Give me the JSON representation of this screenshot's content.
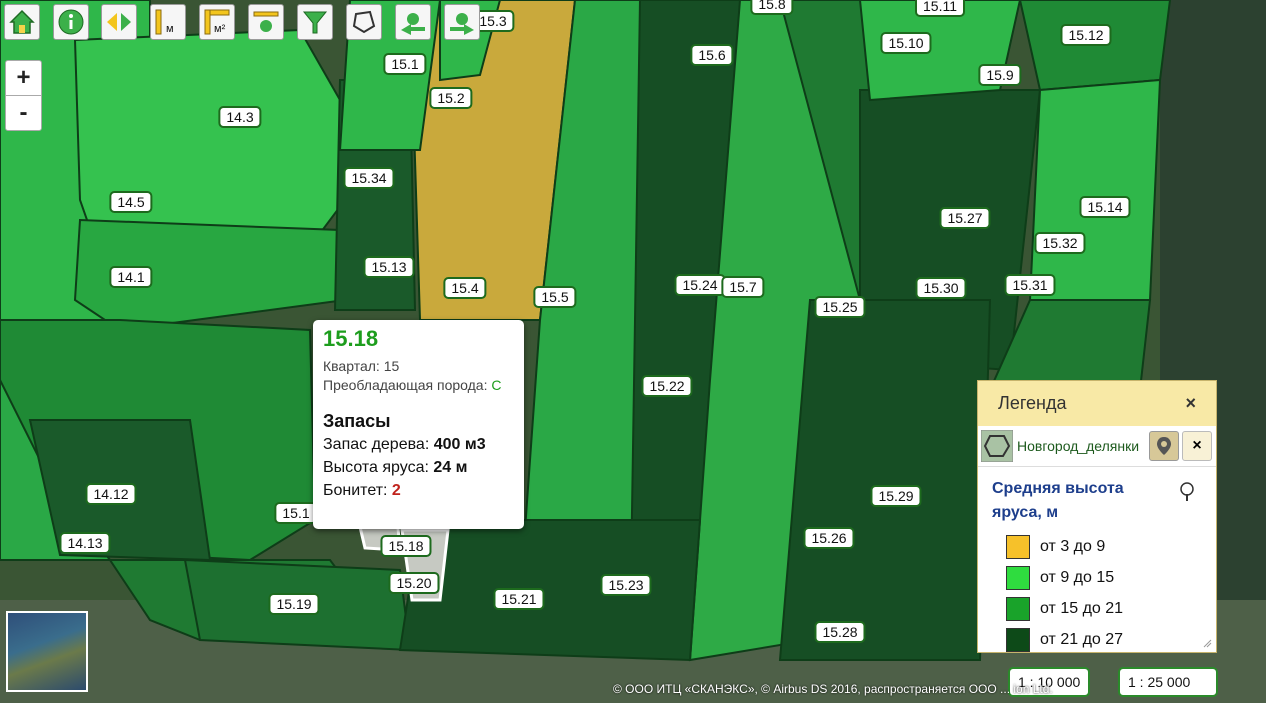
{
  "toolbar": [
    {
      "name": "home-icon"
    },
    {
      "name": "info-icon"
    },
    {
      "name": "pan-icon"
    },
    {
      "name": "measure-length-icon",
      "label": "м"
    },
    {
      "name": "measure-area-icon",
      "label": "м²"
    },
    {
      "name": "layers-icon"
    },
    {
      "name": "filter-icon"
    },
    {
      "name": "polygon-select-icon"
    },
    {
      "name": "zoom-prev-icon"
    },
    {
      "name": "zoom-next-icon"
    }
  ],
  "zoom": {
    "plus": "+",
    "minus": "-"
  },
  "parcels": [
    "15.3",
    "15.8",
    "15.11",
    "15.1",
    "15.6",
    "15.10",
    "15.12",
    "15.9",
    "14.3",
    "15.2",
    "15.34",
    "14.5",
    "15.27",
    "15.14",
    "15.32",
    "15.13",
    "14.1",
    "15.4",
    "15.5",
    "15.24",
    "15.7",
    "15.30",
    "15.31",
    "15.25",
    "15.22",
    "14.12",
    "15.1",
    "15.29",
    "14.13",
    "15.18",
    "15.26",
    "15.20",
    "15.23",
    "15.21",
    "15.19",
    "15.28"
  ],
  "popup": {
    "id": "15.18",
    "kvartal_label": "Квартал:",
    "kvartal_value": "15",
    "species_label": "Преобладающая порода:",
    "species_value": "С",
    "section": "Запасы",
    "stock_label": "Запас дерева:",
    "stock_value": "400 м3",
    "height_label": "Высота яруса:",
    "height_value": "24 м",
    "bonitet_label": "Бонитет:",
    "bonitet_value": "2"
  },
  "legend": {
    "header": "Легенда",
    "close": "×",
    "layer_name": "Новгород_делянки",
    "layer_close": "×",
    "title": "Средняя высота яруса, м",
    "items": [
      {
        "label": "от 3 до 9",
        "color": "#f6c12a"
      },
      {
        "label": "от 9 до 15",
        "color": "#2fdc3f"
      },
      {
        "label": "от 15 до 21",
        "color": "#19a32a"
      },
      {
        "label": "от 21 до 27",
        "color": "#0d4a18"
      }
    ]
  },
  "scales": [
    "1 : 10 000",
    "1 : 25 000"
  ],
  "attribution": "© ООО ИТЦ «СКАНЭКС», © Airbus DS 2016, распространяется ООО ... ion Ltd.",
  "colors": {
    "parcel_light": "#2fb74a",
    "parcel_mid": "#1a8a2e",
    "parcel_dark": "#144d22",
    "parcel_young": "#c9a93c"
  }
}
